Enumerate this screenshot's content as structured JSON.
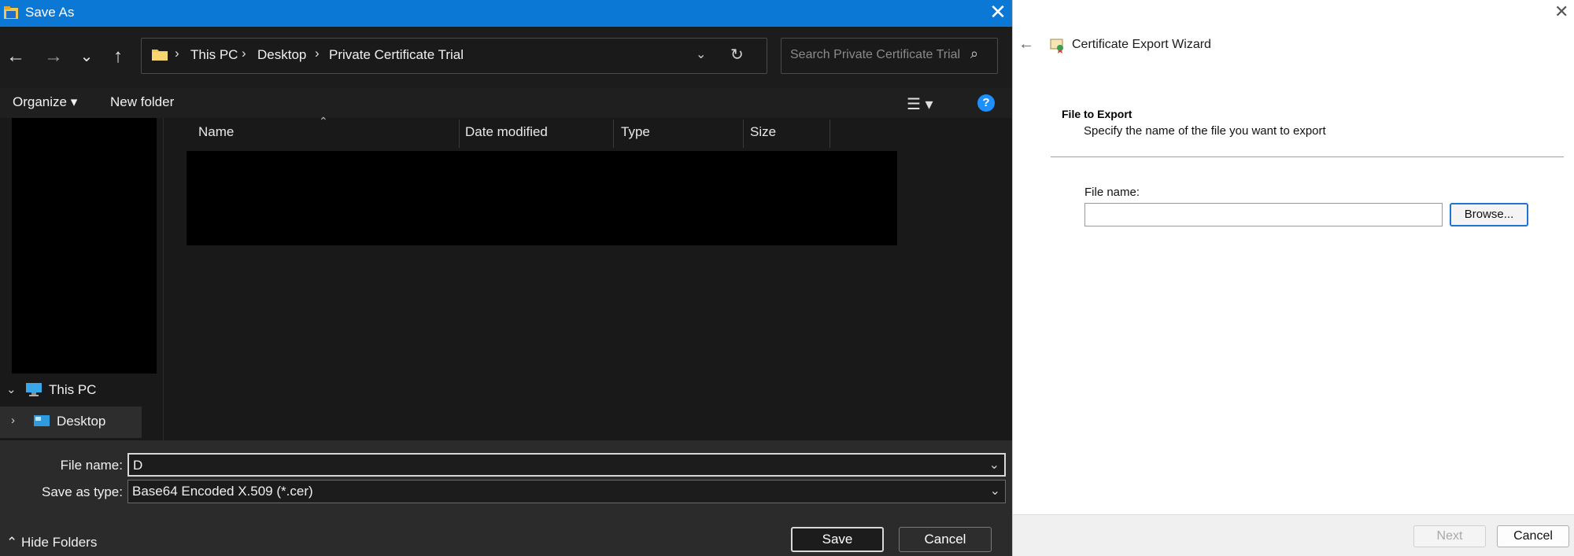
{
  "save_dialog": {
    "title": "Save As",
    "close_glyph": "✕",
    "nav": {
      "back_glyph": "←",
      "forward_glyph": "→",
      "recent_glyph": "⌄",
      "up_glyph": "↑"
    },
    "address": {
      "crumbs": [
        "This PC",
        "Desktop",
        "Private Certificate Trial"
      ],
      "separator": "›",
      "dropdown_glyph": "⌄",
      "refresh_glyph": "↻"
    },
    "search": {
      "placeholder": "Search Private Certificate Trial",
      "icon_glyph": "⌕"
    },
    "commands": {
      "organize": "Organize ▾",
      "new_folder": "New folder",
      "view_glyph": "☰ ▾",
      "help_glyph": "?"
    },
    "tree": [
      {
        "label": "This PC",
        "chevron": "⌄",
        "icon": "computer-icon"
      },
      {
        "label": "Desktop",
        "chevron": "›",
        "icon": "desktop-folder-icon"
      }
    ],
    "columns": [
      "Name",
      "Date modified",
      "Type",
      "Size"
    ],
    "sort_glyph": "⌃",
    "file_name": {
      "label": "File name:",
      "value": "D"
    },
    "save_as_type": {
      "label": "Save as type:",
      "value": "Base64 Encoded X.509 (*.cer)"
    },
    "combo_arrow": "⌄",
    "buttons": {
      "save": "Save",
      "cancel": "Cancel"
    },
    "hide_folders": "⌃  Hide Folders"
  },
  "wizard": {
    "title": "Certificate Export Wizard",
    "close_glyph": "✕",
    "back_glyph": "←",
    "section_title": "File to Export",
    "section_desc": "Specify the name of the file you want to export",
    "file_name_label": "File name:",
    "file_name_value": "",
    "browse": "Browse...",
    "next": "Next",
    "cancel": "Cancel"
  },
  "colors": {
    "title_bar": "#0b78d6",
    "dialog_bg": "#191919",
    "help_badge": "#1e8fff",
    "browse_focus": "#1e73d4"
  }
}
